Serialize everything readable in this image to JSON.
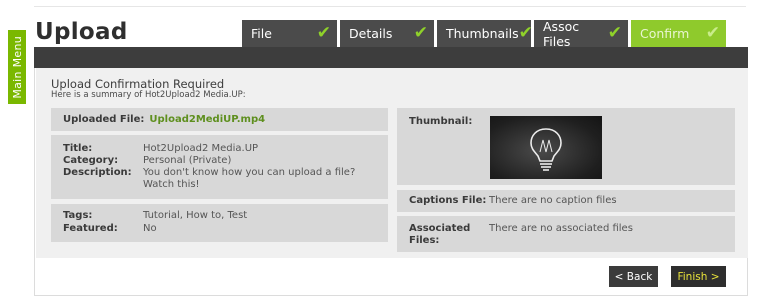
{
  "main_menu_label": "Main Menu",
  "page_title": "Upload",
  "tabs": [
    {
      "label": "File",
      "status": "check"
    },
    {
      "label": "Details",
      "status": "check"
    },
    {
      "label": "Thumbnails",
      "status": "check"
    },
    {
      "label": "Assoc Files",
      "status": "check"
    },
    {
      "label": "Confirm",
      "status": "check"
    }
  ],
  "confirmation": {
    "heading": "Upload Confirmation Required",
    "subtitle": "Here is a summary of Hot2Upload2 Media.UP:"
  },
  "uploaded_file": {
    "label": "Uploaded File:",
    "value": "Upload2MediUP.mp4"
  },
  "details": {
    "title_label": "Title:",
    "title_value": "Hot2Upload2 Media.UP",
    "category_label": "Category:",
    "category_value": "Personal (Private)",
    "description_label": "Description:",
    "description_value": "You don't know how you can upload a file? Watch this!"
  },
  "tags": {
    "tags_label": "Tags:",
    "tags_value": "Tutorial, How to, Test",
    "featured_label": "Featured:",
    "featured_value": "No"
  },
  "thumbnail": {
    "label": "Thumbnail:",
    "icon": "lightbulb-icon"
  },
  "captions": {
    "label": "Captions File:",
    "value": "There are no caption files"
  },
  "associated": {
    "label": "Associated Files:",
    "value": "There are no associated files"
  },
  "buttons": {
    "back": "< Back",
    "finish": "Finish >"
  },
  "colors": {
    "accent_green": "#8fca2c",
    "dark_tab": "#4b4b4b",
    "link_green": "#5e8f1e",
    "finish_text": "#e8e23a"
  }
}
